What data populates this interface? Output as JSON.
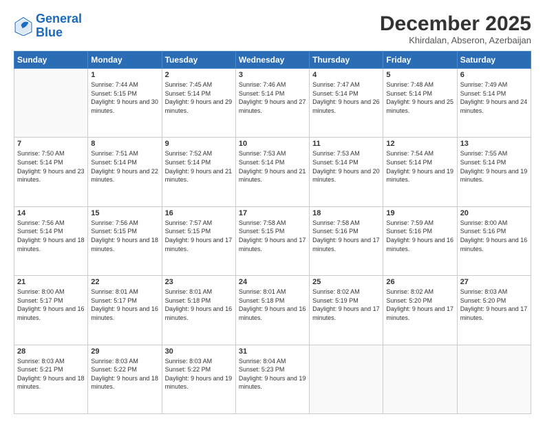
{
  "logo": {
    "line1": "General",
    "line2": "Blue"
  },
  "title": "December 2025",
  "subtitle": "Khirdalan, Abseron, Azerbaijan",
  "days": [
    "Sunday",
    "Monday",
    "Tuesday",
    "Wednesday",
    "Thursday",
    "Friday",
    "Saturday"
  ],
  "cells": [
    {
      "day": null,
      "empty": true
    },
    {
      "day": "1",
      "sunrise": "7:44 AM",
      "sunset": "5:15 PM",
      "daylight": "9 hours and 30 minutes."
    },
    {
      "day": "2",
      "sunrise": "7:45 AM",
      "sunset": "5:14 PM",
      "daylight": "9 hours and 29 minutes."
    },
    {
      "day": "3",
      "sunrise": "7:46 AM",
      "sunset": "5:14 PM",
      "daylight": "9 hours and 27 minutes."
    },
    {
      "day": "4",
      "sunrise": "7:47 AM",
      "sunset": "5:14 PM",
      "daylight": "9 hours and 26 minutes."
    },
    {
      "day": "5",
      "sunrise": "7:48 AM",
      "sunset": "5:14 PM",
      "daylight": "9 hours and 25 minutes."
    },
    {
      "day": "6",
      "sunrise": "7:49 AM",
      "sunset": "5:14 PM",
      "daylight": "9 hours and 24 minutes."
    },
    {
      "day": "7",
      "sunrise": "7:50 AM",
      "sunset": "5:14 PM",
      "daylight": "9 hours and 23 minutes."
    },
    {
      "day": "8",
      "sunrise": "7:51 AM",
      "sunset": "5:14 PM",
      "daylight": "9 hours and 22 minutes."
    },
    {
      "day": "9",
      "sunrise": "7:52 AM",
      "sunset": "5:14 PM",
      "daylight": "9 hours and 21 minutes."
    },
    {
      "day": "10",
      "sunrise": "7:53 AM",
      "sunset": "5:14 PM",
      "daylight": "9 hours and 21 minutes."
    },
    {
      "day": "11",
      "sunrise": "7:53 AM",
      "sunset": "5:14 PM",
      "daylight": "9 hours and 20 minutes."
    },
    {
      "day": "12",
      "sunrise": "7:54 AM",
      "sunset": "5:14 PM",
      "daylight": "9 hours and 19 minutes."
    },
    {
      "day": "13",
      "sunrise": "7:55 AM",
      "sunset": "5:14 PM",
      "daylight": "9 hours and 19 minutes."
    },
    {
      "day": "14",
      "sunrise": "7:56 AM",
      "sunset": "5:14 PM",
      "daylight": "9 hours and 18 minutes."
    },
    {
      "day": "15",
      "sunrise": "7:56 AM",
      "sunset": "5:15 PM",
      "daylight": "9 hours and 18 minutes."
    },
    {
      "day": "16",
      "sunrise": "7:57 AM",
      "sunset": "5:15 PM",
      "daylight": "9 hours and 17 minutes."
    },
    {
      "day": "17",
      "sunrise": "7:58 AM",
      "sunset": "5:15 PM",
      "daylight": "9 hours and 17 minutes."
    },
    {
      "day": "18",
      "sunrise": "7:58 AM",
      "sunset": "5:16 PM",
      "daylight": "9 hours and 17 minutes."
    },
    {
      "day": "19",
      "sunrise": "7:59 AM",
      "sunset": "5:16 PM",
      "daylight": "9 hours and 16 minutes."
    },
    {
      "day": "20",
      "sunrise": "8:00 AM",
      "sunset": "5:16 PM",
      "daylight": "9 hours and 16 minutes."
    },
    {
      "day": "21",
      "sunrise": "8:00 AM",
      "sunset": "5:17 PM",
      "daylight": "9 hours and 16 minutes."
    },
    {
      "day": "22",
      "sunrise": "8:01 AM",
      "sunset": "5:17 PM",
      "daylight": "9 hours and 16 minutes."
    },
    {
      "day": "23",
      "sunrise": "8:01 AM",
      "sunset": "5:18 PM",
      "daylight": "9 hours and 16 minutes."
    },
    {
      "day": "24",
      "sunrise": "8:01 AM",
      "sunset": "5:18 PM",
      "daylight": "9 hours and 16 minutes."
    },
    {
      "day": "25",
      "sunrise": "8:02 AM",
      "sunset": "5:19 PM",
      "daylight": "9 hours and 17 minutes."
    },
    {
      "day": "26",
      "sunrise": "8:02 AM",
      "sunset": "5:20 PM",
      "daylight": "9 hours and 17 minutes."
    },
    {
      "day": "27",
      "sunrise": "8:03 AM",
      "sunset": "5:20 PM",
      "daylight": "9 hours and 17 minutes."
    },
    {
      "day": "28",
      "sunrise": "8:03 AM",
      "sunset": "5:21 PM",
      "daylight": "9 hours and 18 minutes."
    },
    {
      "day": "29",
      "sunrise": "8:03 AM",
      "sunset": "5:22 PM",
      "daylight": "9 hours and 18 minutes."
    },
    {
      "day": "30",
      "sunrise": "8:03 AM",
      "sunset": "5:22 PM",
      "daylight": "9 hours and 19 minutes."
    },
    {
      "day": "31",
      "sunrise": "8:04 AM",
      "sunset": "5:23 PM",
      "daylight": "9 hours and 19 minutes."
    },
    {
      "day": null,
      "empty": true
    },
    {
      "day": null,
      "empty": true
    },
    {
      "day": null,
      "empty": true
    }
  ]
}
